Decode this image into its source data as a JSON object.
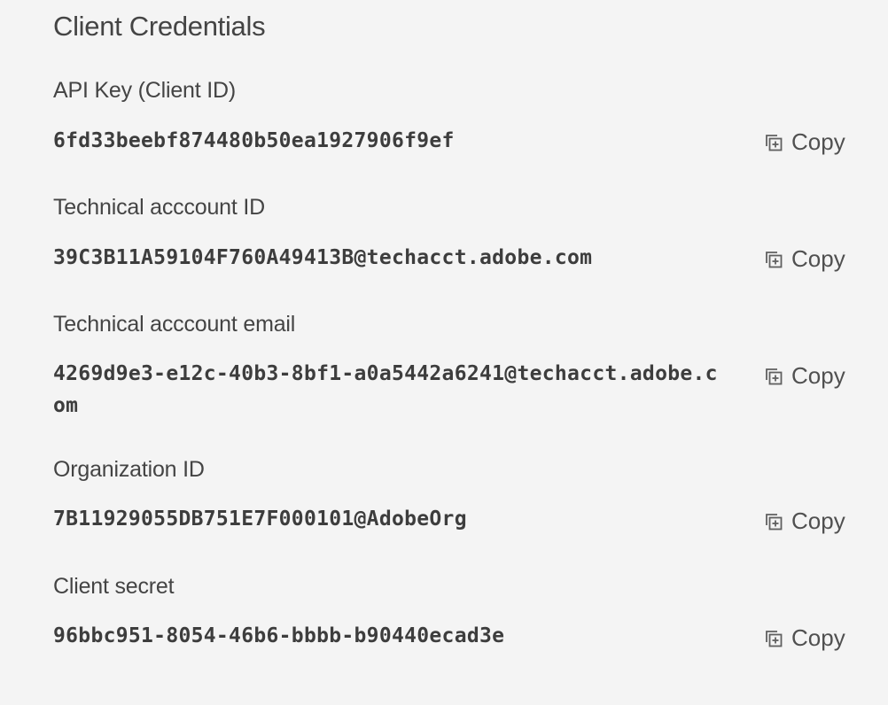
{
  "section": {
    "title": "Client Credentials"
  },
  "copy_label": "Copy",
  "credentials": [
    {
      "label": "API Key (Client ID)",
      "value": "6fd33beebf874480b50ea1927906f9ef"
    },
    {
      "label": "Technical acccount ID",
      "value": "39C3B11A59104F760A49413B@techacct.adobe.com"
    },
    {
      "label": "Technical acccount email",
      "value": "4269d9e3-e12c-40b3-8bf1-a0a5442a6241@techacct.adobe.com"
    },
    {
      "label": "Organization ID",
      "value": "7B11929055DB751E7F000101@AdobeOrg"
    },
    {
      "label": "Client secret",
      "value": "96bbc951-8054-46b6-bbbb-b90440ecad3e"
    }
  ],
  "icons": {
    "copy": "copy-icon"
  },
  "colors": {
    "background": "#f4f4f4",
    "text": "#444444"
  }
}
